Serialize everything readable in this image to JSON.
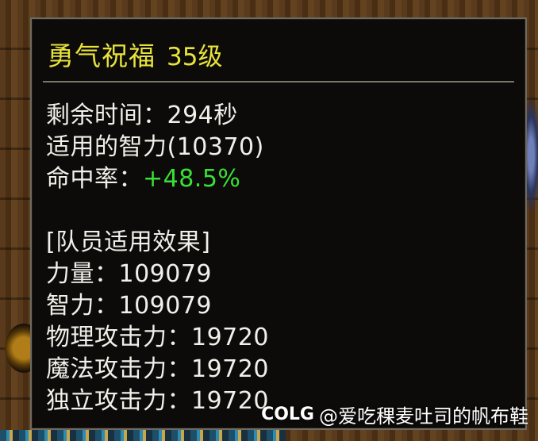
{
  "buff": {
    "title": "勇气祝福",
    "level": "35级"
  },
  "stats": {
    "remaining_time": "剩余时间：294秒",
    "applied_int": "适用的智力(10370)",
    "hit_rate_label": "命中率：",
    "hit_rate_value": "+48.5%"
  },
  "team": {
    "header": "[队员适用效果]",
    "strength": "力量：109079",
    "intelligence": "智力：109079",
    "physical_attack": "物理攻击力：19720",
    "magic_attack": "魔法攻击力：19720",
    "independent_attack": "独立攻击力：19720"
  },
  "watermark": {
    "brand": "COLG",
    "handle": "@爱吃稞麦吐司的帆布鞋"
  }
}
